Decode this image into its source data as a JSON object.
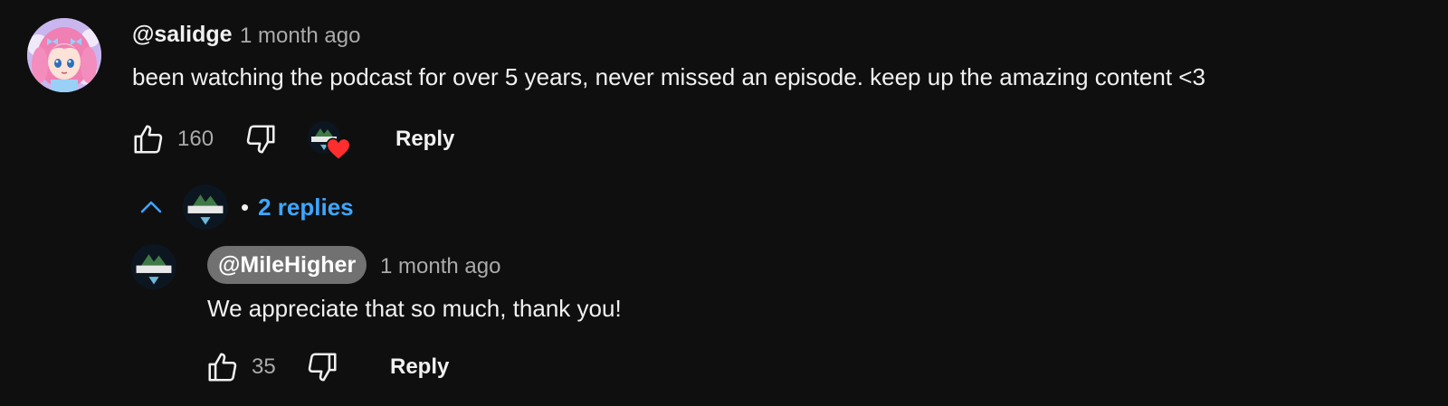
{
  "comment": {
    "author": "@salidge",
    "timestamp": "1 month ago",
    "text": "been watching the podcast for over 5 years, never missed an episode. keep up the amazing content <3",
    "like_count": "160",
    "reply_label": "Reply",
    "avatar_icon": "anime-girl-avatar",
    "creator_heart_icon": "creator-heart-icon"
  },
  "replies_toggle": {
    "dot": "•",
    "label": "2 replies",
    "icon": "chevron-up-icon"
  },
  "reply": {
    "author": "@MileHigher",
    "timestamp": "1 month ago",
    "text": "We appreciate that so much, thank you!",
    "like_count": "35",
    "reply_label": "Reply",
    "avatar_icon": "mile-higher-podcast-logo"
  },
  "colors": {
    "background": "#0f0f0f",
    "text_primary": "#f1f1f1",
    "text_secondary": "#aaaaaa",
    "link_blue": "#3ea6ff",
    "author_pill": "#717171",
    "heart_red": "#ff0033"
  }
}
